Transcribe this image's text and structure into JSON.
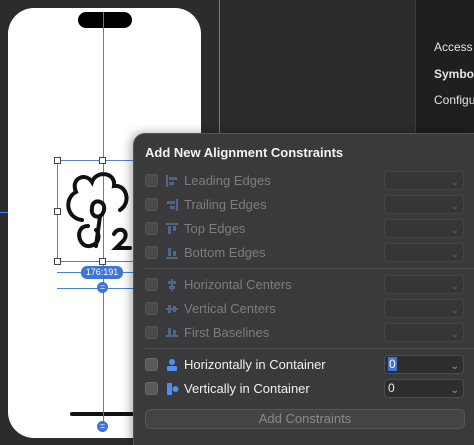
{
  "canvas": {
    "size_label": "176:191",
    "equal_icon": "equal-icon"
  },
  "inspector": {
    "items": [
      "Access",
      "Symbo",
      "Configu"
    ]
  },
  "popover": {
    "title": "Add New Alignment Constraints",
    "rows_edges": [
      {
        "label": "Leading Edges",
        "icon": "leading-edges-icon",
        "checked": false,
        "enabled": false
      },
      {
        "label": "Trailing Edges",
        "icon": "trailing-edges-icon",
        "checked": false,
        "enabled": false
      },
      {
        "label": "Top Edges",
        "icon": "top-edges-icon",
        "checked": false,
        "enabled": false
      },
      {
        "label": "Bottom Edges",
        "icon": "bottom-edges-icon",
        "checked": false,
        "enabled": false
      }
    ],
    "rows_centers": [
      {
        "label": "Horizontal Centers",
        "icon": "horizontal-centers-icon",
        "checked": false,
        "enabled": false
      },
      {
        "label": "Vertical Centers",
        "icon": "vertical-centers-icon",
        "checked": false,
        "enabled": false
      },
      {
        "label": "First Baselines",
        "icon": "first-baselines-icon",
        "checked": false,
        "enabled": false
      }
    ],
    "rows_container": [
      {
        "label": "Horizontally in Container",
        "icon": "horizontally-in-container-icon",
        "checked": false,
        "enabled": true,
        "value": "0"
      },
      {
        "label": "Vertically in Container",
        "icon": "vertically-in-container-icon",
        "checked": false,
        "enabled": true,
        "value": "0"
      }
    ],
    "add_button_label": "Add Constraints",
    "chevron": "⌄"
  },
  "colors": {
    "accent": "#3d74d6",
    "guide": "#4a7fd8",
    "popover_bg": "#3a3a3c"
  }
}
